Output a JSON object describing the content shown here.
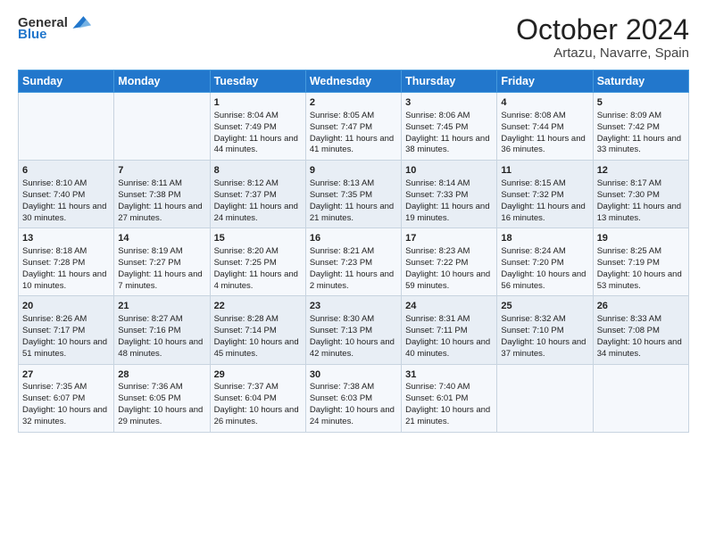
{
  "header": {
    "logo_general": "General",
    "logo_blue": "Blue",
    "main_title": "October 2024",
    "subtitle": "Artazu, Navarre, Spain"
  },
  "days_of_week": [
    "Sunday",
    "Monday",
    "Tuesday",
    "Wednesday",
    "Thursday",
    "Friday",
    "Saturday"
  ],
  "weeks": [
    [
      {
        "num": "",
        "sunrise": "",
        "sunset": "",
        "daylight": ""
      },
      {
        "num": "",
        "sunrise": "",
        "sunset": "",
        "daylight": ""
      },
      {
        "num": "1",
        "sunrise": "Sunrise: 8:04 AM",
        "sunset": "Sunset: 7:49 PM",
        "daylight": "Daylight: 11 hours and 44 minutes."
      },
      {
        "num": "2",
        "sunrise": "Sunrise: 8:05 AM",
        "sunset": "Sunset: 7:47 PM",
        "daylight": "Daylight: 11 hours and 41 minutes."
      },
      {
        "num": "3",
        "sunrise": "Sunrise: 8:06 AM",
        "sunset": "Sunset: 7:45 PM",
        "daylight": "Daylight: 11 hours and 38 minutes."
      },
      {
        "num": "4",
        "sunrise": "Sunrise: 8:08 AM",
        "sunset": "Sunset: 7:44 PM",
        "daylight": "Daylight: 11 hours and 36 minutes."
      },
      {
        "num": "5",
        "sunrise": "Sunrise: 8:09 AM",
        "sunset": "Sunset: 7:42 PM",
        "daylight": "Daylight: 11 hours and 33 minutes."
      }
    ],
    [
      {
        "num": "6",
        "sunrise": "Sunrise: 8:10 AM",
        "sunset": "Sunset: 7:40 PM",
        "daylight": "Daylight: 11 hours and 30 minutes."
      },
      {
        "num": "7",
        "sunrise": "Sunrise: 8:11 AM",
        "sunset": "Sunset: 7:38 PM",
        "daylight": "Daylight: 11 hours and 27 minutes."
      },
      {
        "num": "8",
        "sunrise": "Sunrise: 8:12 AM",
        "sunset": "Sunset: 7:37 PM",
        "daylight": "Daylight: 11 hours and 24 minutes."
      },
      {
        "num": "9",
        "sunrise": "Sunrise: 8:13 AM",
        "sunset": "Sunset: 7:35 PM",
        "daylight": "Daylight: 11 hours and 21 minutes."
      },
      {
        "num": "10",
        "sunrise": "Sunrise: 8:14 AM",
        "sunset": "Sunset: 7:33 PM",
        "daylight": "Daylight: 11 hours and 19 minutes."
      },
      {
        "num": "11",
        "sunrise": "Sunrise: 8:15 AM",
        "sunset": "Sunset: 7:32 PM",
        "daylight": "Daylight: 11 hours and 16 minutes."
      },
      {
        "num": "12",
        "sunrise": "Sunrise: 8:17 AM",
        "sunset": "Sunset: 7:30 PM",
        "daylight": "Daylight: 11 hours and 13 minutes."
      }
    ],
    [
      {
        "num": "13",
        "sunrise": "Sunrise: 8:18 AM",
        "sunset": "Sunset: 7:28 PM",
        "daylight": "Daylight: 11 hours and 10 minutes."
      },
      {
        "num": "14",
        "sunrise": "Sunrise: 8:19 AM",
        "sunset": "Sunset: 7:27 PM",
        "daylight": "Daylight: 11 hours and 7 minutes."
      },
      {
        "num": "15",
        "sunrise": "Sunrise: 8:20 AM",
        "sunset": "Sunset: 7:25 PM",
        "daylight": "Daylight: 11 hours and 4 minutes."
      },
      {
        "num": "16",
        "sunrise": "Sunrise: 8:21 AM",
        "sunset": "Sunset: 7:23 PM",
        "daylight": "Daylight: 11 hours and 2 minutes."
      },
      {
        "num": "17",
        "sunrise": "Sunrise: 8:23 AM",
        "sunset": "Sunset: 7:22 PM",
        "daylight": "Daylight: 10 hours and 59 minutes."
      },
      {
        "num": "18",
        "sunrise": "Sunrise: 8:24 AM",
        "sunset": "Sunset: 7:20 PM",
        "daylight": "Daylight: 10 hours and 56 minutes."
      },
      {
        "num": "19",
        "sunrise": "Sunrise: 8:25 AM",
        "sunset": "Sunset: 7:19 PM",
        "daylight": "Daylight: 10 hours and 53 minutes."
      }
    ],
    [
      {
        "num": "20",
        "sunrise": "Sunrise: 8:26 AM",
        "sunset": "Sunset: 7:17 PM",
        "daylight": "Daylight: 10 hours and 51 minutes."
      },
      {
        "num": "21",
        "sunrise": "Sunrise: 8:27 AM",
        "sunset": "Sunset: 7:16 PM",
        "daylight": "Daylight: 10 hours and 48 minutes."
      },
      {
        "num": "22",
        "sunrise": "Sunrise: 8:28 AM",
        "sunset": "Sunset: 7:14 PM",
        "daylight": "Daylight: 10 hours and 45 minutes."
      },
      {
        "num": "23",
        "sunrise": "Sunrise: 8:30 AM",
        "sunset": "Sunset: 7:13 PM",
        "daylight": "Daylight: 10 hours and 42 minutes."
      },
      {
        "num": "24",
        "sunrise": "Sunrise: 8:31 AM",
        "sunset": "Sunset: 7:11 PM",
        "daylight": "Daylight: 10 hours and 40 minutes."
      },
      {
        "num": "25",
        "sunrise": "Sunrise: 8:32 AM",
        "sunset": "Sunset: 7:10 PM",
        "daylight": "Daylight: 10 hours and 37 minutes."
      },
      {
        "num": "26",
        "sunrise": "Sunrise: 8:33 AM",
        "sunset": "Sunset: 7:08 PM",
        "daylight": "Daylight: 10 hours and 34 minutes."
      }
    ],
    [
      {
        "num": "27",
        "sunrise": "Sunrise: 7:35 AM",
        "sunset": "Sunset: 6:07 PM",
        "daylight": "Daylight: 10 hours and 32 minutes."
      },
      {
        "num": "28",
        "sunrise": "Sunrise: 7:36 AM",
        "sunset": "Sunset: 6:05 PM",
        "daylight": "Daylight: 10 hours and 29 minutes."
      },
      {
        "num": "29",
        "sunrise": "Sunrise: 7:37 AM",
        "sunset": "Sunset: 6:04 PM",
        "daylight": "Daylight: 10 hours and 26 minutes."
      },
      {
        "num": "30",
        "sunrise": "Sunrise: 7:38 AM",
        "sunset": "Sunset: 6:03 PM",
        "daylight": "Daylight: 10 hours and 24 minutes."
      },
      {
        "num": "31",
        "sunrise": "Sunrise: 7:40 AM",
        "sunset": "Sunset: 6:01 PM",
        "daylight": "Daylight: 10 hours and 21 minutes."
      },
      {
        "num": "",
        "sunrise": "",
        "sunset": "",
        "daylight": ""
      },
      {
        "num": "",
        "sunrise": "",
        "sunset": "",
        "daylight": ""
      }
    ]
  ]
}
